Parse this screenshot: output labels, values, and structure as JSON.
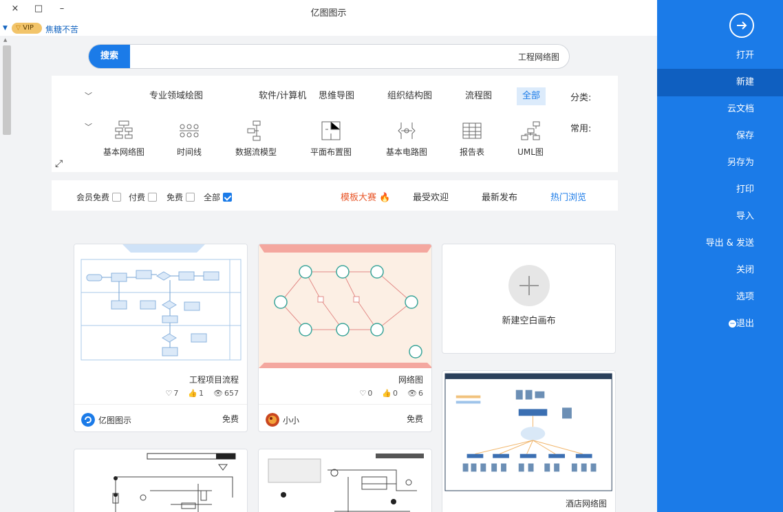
{
  "app": {
    "title": "亿图图示",
    "window_controls": [
      "×",
      "□",
      "–"
    ]
  },
  "user": {
    "vip": "VIP",
    "name": "焦糖不苦"
  },
  "sidebar": {
    "items": [
      {
        "label": "打开"
      },
      {
        "label": "新建"
      },
      {
        "label": "云文档"
      },
      {
        "label": "保存"
      },
      {
        "label": "另存为"
      },
      {
        "label": "打印"
      },
      {
        "label": "导入"
      },
      {
        "label": "导出 & 发送"
      },
      {
        "label": "关闭"
      },
      {
        "label": "选项"
      },
      {
        "label": "退出"
      }
    ],
    "active": "新建"
  },
  "search": {
    "button": "搜索",
    "value": "工程网络图"
  },
  "categories": {
    "label": "分类:",
    "items": [
      "全部",
      "流程图",
      "组织结构图",
      "思维导图",
      "软件/计算机",
      "专业领域绘图"
    ],
    "active": "全部"
  },
  "common": {
    "label": "常用:",
    "items": [
      {
        "label": "UML图",
        "icon": "uml-icon"
      },
      {
        "label": "报告表",
        "icon": "report-table-icon"
      },
      {
        "label": "基本电路图",
        "icon": "circuit-icon"
      },
      {
        "label": "平面布置图",
        "icon": "floor-plan-icon"
      },
      {
        "label": "数据流模型",
        "icon": "data-flow-icon"
      },
      {
        "label": "时间线",
        "icon": "timeline-icon"
      },
      {
        "label": "基本网络图",
        "icon": "network-icon"
      }
    ]
  },
  "tabs": [
    {
      "label": "热门浏览",
      "active": true
    },
    {
      "label": "最新发布"
    },
    {
      "label": "最受欢迎"
    },
    {
      "label": "模板大赛",
      "icon": "fire-icon"
    }
  ],
  "filters": [
    {
      "label": "全部",
      "checked": true
    },
    {
      "label": "免费",
      "checked": false
    },
    {
      "label": "付费",
      "checked": false
    },
    {
      "label": "会员免费",
      "checked": false
    }
  ],
  "new_card": {
    "label": "新建空白画布"
  },
  "templates": [
    {
      "title": "工程项目流程",
      "views": "657",
      "likes": "1",
      "favs": "7",
      "author": "亿图图示",
      "price": "免费"
    },
    {
      "title": "网络图",
      "views": "6",
      "likes": "0",
      "favs": "0",
      "author": "小小",
      "price": "免费"
    },
    {
      "title": "酒店网络图"
    }
  ],
  "colors": {
    "accent": "#1b7be8",
    "sidebar": "#1b7be8",
    "sidebar_active": "#0f5fc0",
    "fire": "#e8572a"
  }
}
